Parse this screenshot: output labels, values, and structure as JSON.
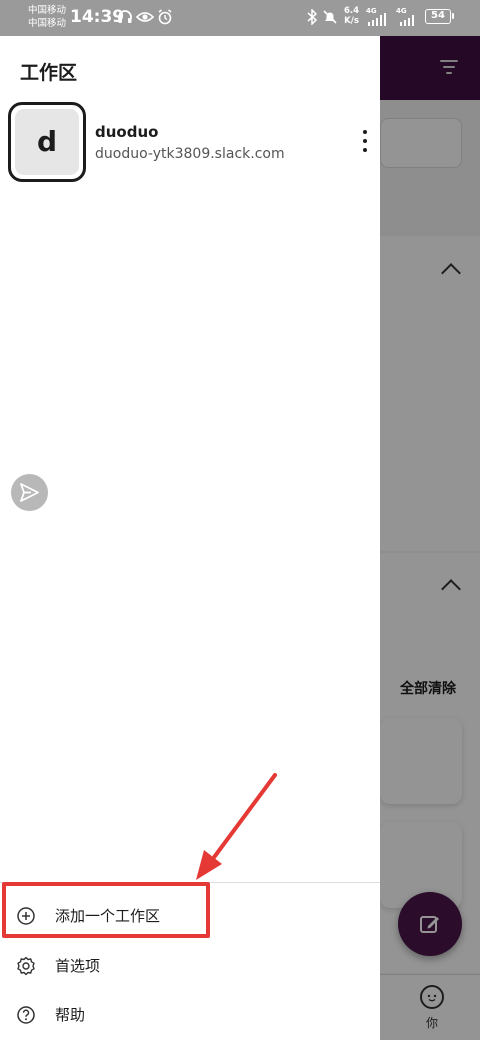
{
  "status_bar": {
    "carrier_1": "中国移动",
    "carrier_2": "中国移动",
    "time": "14:39",
    "speed_value": "6.4",
    "speed_unit": "K/s",
    "network_1": "4G",
    "network_2": "4G",
    "battery": "54"
  },
  "drawer": {
    "title": "工作区",
    "workspace": {
      "avatar_letter": "d",
      "name": "duoduo",
      "url": "duoduo-ytk3809.slack.com"
    },
    "menu": [
      {
        "label": "添加一个工作区",
        "icon": "plus-circle-icon"
      },
      {
        "label": "首选项",
        "icon": "gear-icon"
      },
      {
        "label": "帮助",
        "icon": "help-circle-icon"
      }
    ]
  },
  "background": {
    "clear_all_label": "全部清除",
    "tab_you_label": "你"
  },
  "colors": {
    "header_purple": "#3f0e40",
    "fab_purple": "#4a154b",
    "annotation_red": "#e53935"
  }
}
